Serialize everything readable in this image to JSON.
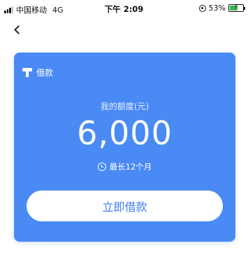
{
  "status_bar": {
    "carrier": "中国移动",
    "network": "4G",
    "time": "下午 2:09",
    "battery_percent": "53%"
  },
  "nav": {
    "back_icon": "chevron-left-icon"
  },
  "card": {
    "title": "借款",
    "title_icon": "loan-icon",
    "quota_label": "我的额度(元)",
    "quota_amount": "6,000",
    "term_icon": "clock-icon",
    "term_text": "最长12个月",
    "button_label": "立即借款",
    "accent_color": "#4a8af4",
    "button_text_color": "#3c7cf0"
  }
}
